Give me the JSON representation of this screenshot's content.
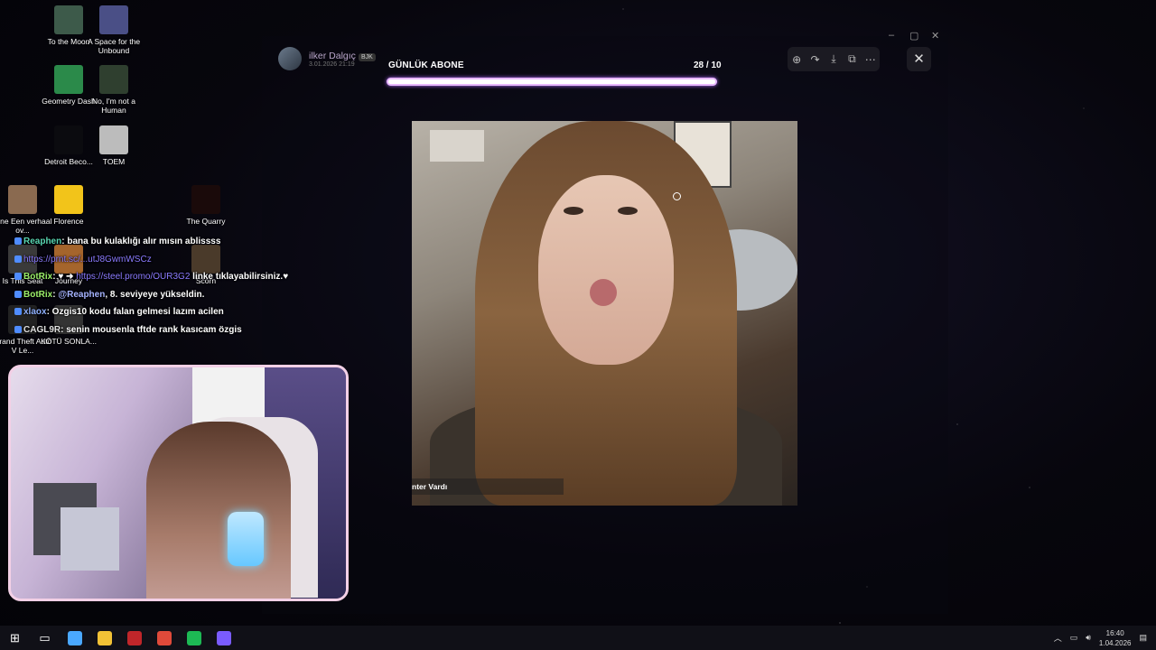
{
  "desktop": {
    "icons": [
      {
        "label": "To the Moon",
        "color": "#3d5a4a"
      },
      {
        "label": "A Space for the Unbound",
        "color": "#4a4f86"
      },
      {
        "label": "Geometry Dash",
        "color": "#2b8a4a"
      },
      {
        "label": "No, I'm not a Human",
        "color": "#2f3f2f"
      },
      {
        "label": "Detroit Beco...",
        "color": "#0b0b0f"
      },
      {
        "label": "TOEM",
        "color": "#bcbcbc"
      },
      {
        "label": "Pine Een verhaal ov...",
        "color": "#8a6a50"
      },
      {
        "label": "Florence",
        "color": "#f2c41a"
      },
      {
        "label": "The Quarry",
        "color": "#1a0a0a"
      },
      {
        "label": "Is This Seat",
        "color": "#3a3a3a"
      },
      {
        "label": "Journey",
        "color": "#a5652c"
      },
      {
        "label": "Scorn",
        "color": "#4a3a2a"
      },
      {
        "label": "Grand Theft Auto V Le...",
        "color": "#222222"
      },
      {
        "label": "KÖTÜ SONLA...",
        "color": "#333333"
      }
    ]
  },
  "viewer": {
    "author": "ilker Dalgıç",
    "author_badge": "BJK",
    "date": "3.01.2026 21:19",
    "toolbar": {
      "zoom": "zoom-in-icon",
      "rotate": "rotate-icon",
      "download": "download-icon",
      "open": "open-external-icon",
      "more": "more-icon",
      "close": "✕"
    },
    "photo_caption": "nter Vardı"
  },
  "window_controls": {
    "minimize": "–",
    "maximize": "▢",
    "close": "✕"
  },
  "sub_goal": {
    "label": "GÜNLÜK ABONE",
    "count": "28 / 10",
    "progress": 1.0,
    "bar_color": "#e8b8ff"
  },
  "chat": [
    {
      "user": "Reaphen",
      "user_color": "#59d6b2",
      "text": ": bana bu kulaklığı alır mısın ablissss"
    },
    {
      "user": "",
      "user_color": "#8b7bff",
      "text": "https://prnt.sc/...utJ8GwmWSCz",
      "is_link": true
    },
    {
      "user": "BotRix",
      "user_color": "#9cf06a",
      "text": ": ♥ ➜ ",
      "link": "https://steel.promo/OUR3G2",
      "after": " linke tıklayabilirsiniz.♥"
    },
    {
      "user": "BotRix",
      "user_color": "#9cf06a",
      "text": ": ",
      "mention": "@Reaphen",
      "after": ", 8. seviyeye yükseldin."
    },
    {
      "user": "xlaox",
      "user_color": "#8fb0ff",
      "text": ": Ozgis10 kodu falan gelmesi lazım acilen"
    },
    {
      "user": "CAGL9R",
      "user_color": "#e0e0e0",
      "text": ": senin mousenla tftde rank kasıcam özgis"
    }
  ],
  "taskbar": {
    "items": [
      {
        "name": "start-icon",
        "glyph": "⊞"
      },
      {
        "name": "task-view-icon",
        "glyph": "▭"
      },
      {
        "name": "copilot-icon",
        "color": "#4aa8ff"
      },
      {
        "name": "file-explorer-icon",
        "color": "#f2c236"
      },
      {
        "name": "voice-mod-icon",
        "color": "#c0262a"
      },
      {
        "name": "chrome-icon",
        "color": "#e04a3a"
      },
      {
        "name": "spotify-icon",
        "color": "#1db954"
      },
      {
        "name": "app-icon",
        "color": "#7a5cff"
      }
    ],
    "time": "16:40",
    "date": "1.04.2026"
  }
}
